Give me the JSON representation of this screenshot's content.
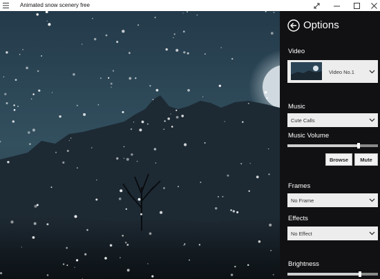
{
  "window": {
    "title": "Animated snow scenery free",
    "controls": [
      "expand-icon",
      "minimize-icon",
      "maximize-icon",
      "close-icon"
    ]
  },
  "panel": {
    "title": "Options",
    "video": {
      "label": "Video",
      "selected": "Video No.1"
    },
    "music": {
      "label": "Music",
      "selected": "Cute Calls"
    },
    "music_volume": {
      "label": "Music Volume",
      "level": 0.79
    },
    "buttons": {
      "browse": "Browse",
      "mute": "Mute"
    },
    "frames": {
      "label": "Frames",
      "selected": "No Frame"
    },
    "effects": {
      "label": "Effects",
      "selected": "No Effect"
    },
    "brightness": {
      "label": "Brightness",
      "level": 0.8
    }
  },
  "colors": {
    "panel_bg": "#141416",
    "dropdown_bg": "#ededed",
    "sky": "#2c4556"
  }
}
